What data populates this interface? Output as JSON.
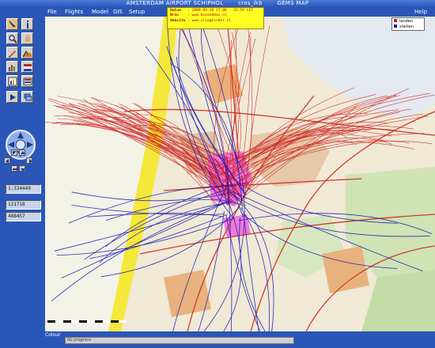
{
  "window": {
    "title_left": "AMSTERDAM AIRPORT SCHIPHOL",
    "title_mid": "cros_ikb",
    "title_right": "GEMS MAP"
  },
  "menu": {
    "items": [
      "File",
      "Flights",
      "Model",
      "GIS",
      "Setup"
    ],
    "help": "Help"
  },
  "infobox": {
    "rows": [
      {
        "key": "Datum",
        "value": ": 2009-09-18  17:00 - 23:59 CET"
      },
      {
        "key": "Bron",
        "value": ": www.bezoekbas.nl"
      },
      {
        "key": "Website",
        "value": ": www.vliegbinder.nl"
      }
    ]
  },
  "legend": {
    "entries": [
      {
        "label": "landen",
        "color": "#cc1a1a"
      },
      {
        "label": "starten",
        "color": "#1a1ab4"
      }
    ]
  },
  "readouts": {
    "scale": "1:334449",
    "x": "121718",
    "y": "488457"
  },
  "status": {
    "colour": "Colour",
    "progress": "No progress"
  },
  "tools": [
    "select-arrow-icon",
    "info-icon",
    "zoom-icon",
    "hand-icon",
    "pencil-icon",
    "terrain-icon",
    "chart-icon",
    "flag-icon",
    "bar-chart-icon",
    "gauge-icon",
    "play-icon",
    "layers-icon"
  ],
  "colors": {
    "landing_tracks": "#cc1a1a",
    "takeoff_tracks": "#1a1ab4",
    "frame": "#2a56b8",
    "infobox": "#ffff22"
  }
}
